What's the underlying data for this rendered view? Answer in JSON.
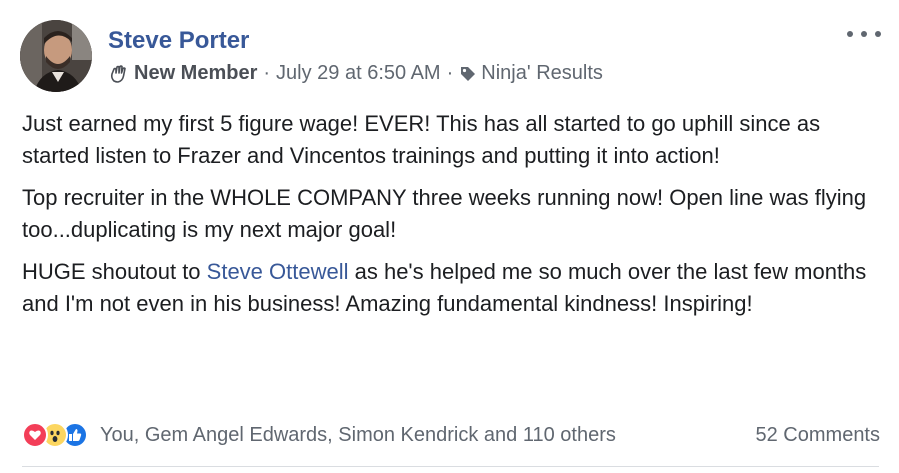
{
  "post": {
    "author": "Steve Porter",
    "badge": "New Member",
    "badge_icon": "wave-hand-icon",
    "separator": "·",
    "timestamp": "July 29 at 6:50 AM",
    "topic_icon": "tag-icon",
    "topic": "Ninja' Results",
    "paragraphs": {
      "p1": "Just earned my first 5 figure wage! EVER! This has all started to go uphill since as started listen to Frazer and Vincentos trainings and putting it into action!",
      "p2": "Top recruiter in the WHOLE COMPANY three weeks running now! Open line was flying too...duplicating is my next major goal!",
      "p3_before": "HUGE shoutout to ",
      "p3_mention": "Steve Ottewell",
      "p3_after": " as he's helped me so much over the last few months and I'm not even in his business! Amazing fundamental kindness! Inspiring!"
    }
  },
  "footer": {
    "reactions": [
      "love-icon",
      "wow-icon",
      "like-icon"
    ],
    "reaction_names": "You, Gem Angel Edwards, Simon Kendrick and 110 others",
    "comments": "52 Comments"
  },
  "colors": {
    "link": "#385898",
    "meta_text": "#606770",
    "love": "#f33e58",
    "wow": "#fcd660",
    "like": "#1b74e4"
  }
}
